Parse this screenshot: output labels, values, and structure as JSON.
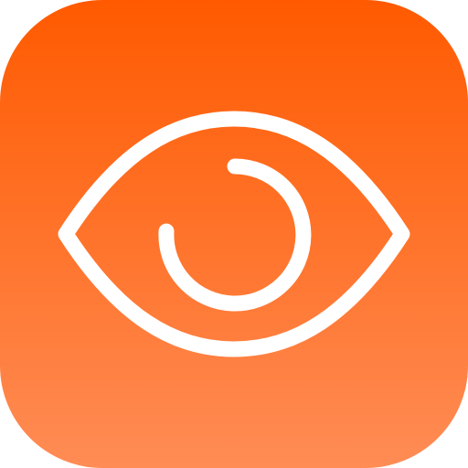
{
  "icon": {
    "glyph": "eye-icon",
    "background_top": "#FF5A00",
    "background_bottom": "#FF8C55",
    "stroke_color": "#FFFFFF"
  }
}
